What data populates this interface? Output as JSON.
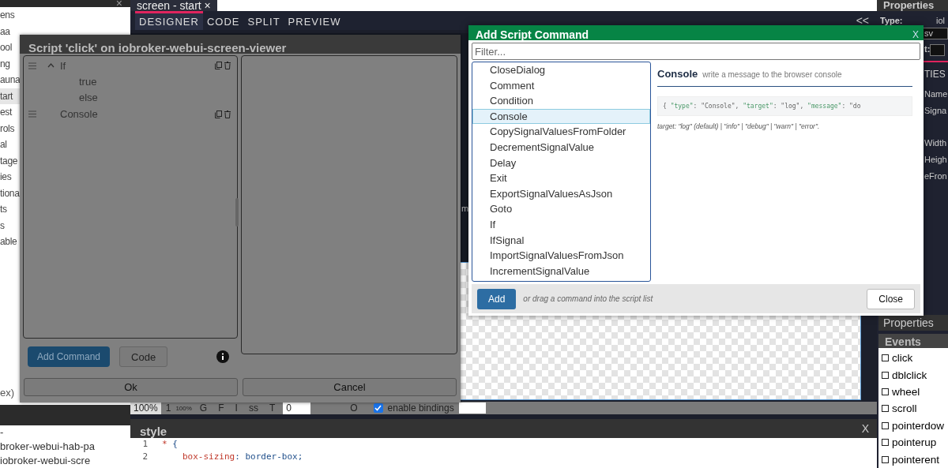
{
  "left_panel": {
    "close": "×",
    "items": [
      {
        "label": "ens",
        "selected": false
      },
      {
        "label": "aa",
        "selected": false
      },
      {
        "label": "ool",
        "selected": false
      },
      {
        "label": "ng",
        "selected": false
      },
      {
        "label": "auna",
        "selected": false
      },
      {
        "label": "tart",
        "selected": true
      },
      {
        "label": "est",
        "selected": false
      },
      {
        "label": "rols",
        "selected": false
      },
      {
        "label": "al",
        "selected": false
      },
      {
        "label": "tage",
        "selected": false
      },
      {
        "label": "ies",
        "selected": false
      },
      {
        "label": "tiona",
        "selected": false
      },
      {
        "label": "ts",
        "selected": false
      },
      {
        "label": "s",
        "selected": false
      },
      {
        "label": "able",
        "selected": false
      }
    ],
    "footer_text": "ex)",
    "tree_items": [
      {
        "label": "-"
      },
      {
        "label": "broker-webui-hab-pa"
      },
      {
        "label": "iobroker-webui-scre"
      }
    ]
  },
  "editor": {
    "document_tab": {
      "label": "screen - start",
      "close": "×"
    },
    "view_tabs": [
      {
        "label": "DESIGNER",
        "selected": true
      },
      {
        "label": "CODE",
        "selected": false
      },
      {
        "label": "SPLIT",
        "selected": false
      },
      {
        "label": "PREVIEW",
        "selected": false
      }
    ],
    "collapse": "<<",
    "canvas_text": "m",
    "toolbar": {
      "zoom": "100%",
      "step": "1",
      "small_zoom": "100%",
      "letters": [
        "G",
        "F",
        "I",
        "ss",
        "T"
      ],
      "value": "0",
      "mark": "O",
      "bindings": {
        "label": "enable bindings",
        "checked": true
      }
    },
    "style_panel": {
      "title": "style",
      "close": "X",
      "lines": [
        {
          "number": "1",
          "tokens": [
            {
              "text": "* ",
              "kind": "selector"
            },
            {
              "text": "{",
              "kind": "punct"
            }
          ]
        },
        {
          "number": "2",
          "tokens": [
            {
              "text": "box-sizing",
              "kind": "property"
            },
            {
              "text": ": ",
              "kind": "punct"
            },
            {
              "text": "border-box",
              "kind": "value"
            },
            {
              "text": ";",
              "kind": "punct"
            }
          ]
        }
      ]
    }
  },
  "properties": {
    "title": "Properties",
    "type_label": "Type:",
    "type_value": "iol",
    "field_value": "sv",
    "field2_label": "t:",
    "section": "TIES",
    "labels": [
      "Name",
      "Signa",
      "Width",
      "Heigh",
      "eFron"
    ],
    "lower_title": "Properties",
    "events_title": "Events",
    "events": [
      {
        "label": "click",
        "checked": false
      },
      {
        "label": "dblclick",
        "checked": false
      },
      {
        "label": "wheel",
        "checked": false
      },
      {
        "label": "scroll",
        "checked": false
      },
      {
        "label": "pointerdow",
        "checked": false
      },
      {
        "label": "pointerup",
        "checked": false
      },
      {
        "label": "pointerent",
        "checked": false
      }
    ]
  },
  "script_dialog": {
    "title": "Script 'click' on iobroker-webui-screen-viewer",
    "commands": [
      {
        "label": "If",
        "expanded": true,
        "children": [
          {
            "label": "true"
          },
          {
            "label": "else"
          }
        ]
      },
      {
        "label": "Console"
      }
    ],
    "add_button": "Add Command",
    "code_button": "Code",
    "ok": "Ok",
    "cancel": "Cancel"
  },
  "command_dialog": {
    "title": "Add Script Command",
    "close": "X",
    "filter": {
      "placeholder": "Filter..."
    },
    "commands": [
      {
        "label": "CloseDialog",
        "selected": false
      },
      {
        "label": "Comment",
        "selected": false
      },
      {
        "label": "Condition",
        "selected": false
      },
      {
        "label": "Console",
        "selected": true
      },
      {
        "label": "CopySignalValuesFromFolder",
        "selected": false
      },
      {
        "label": "DecrementSignalValue",
        "selected": false
      },
      {
        "label": "Delay",
        "selected": false
      },
      {
        "label": "Exit",
        "selected": false
      },
      {
        "label": "ExportSignalValuesAsJson",
        "selected": false
      },
      {
        "label": "Goto",
        "selected": false
      },
      {
        "label": "If",
        "selected": false
      },
      {
        "label": "IfSignal",
        "selected": false
      },
      {
        "label": "ImportSignalValuesFromJson",
        "selected": false
      },
      {
        "label": "IncrementSignalValue",
        "selected": false
      }
    ],
    "detail": {
      "name": "Console",
      "description": "write a message to the browser console",
      "example": [
        {
          "text": "{ ",
          "kind": "punct"
        },
        {
          "text": "\"type\"",
          "kind": "key"
        },
        {
          "text": ": \"Console\", ",
          "kind": "punct"
        },
        {
          "text": "\"target\"",
          "kind": "key"
        },
        {
          "text": ": \"log\", ",
          "kind": "punct"
        },
        {
          "text": "\"message\"",
          "kind": "key"
        },
        {
          "text": ": \"do",
          "kind": "punct"
        }
      ],
      "note": "target: \"log\" (default) | \"info\" | \"debug\" | \"warn\" | \"error\"."
    },
    "add": "Add",
    "hint": "or drag a command into the script list",
    "close_button": "Close"
  }
}
